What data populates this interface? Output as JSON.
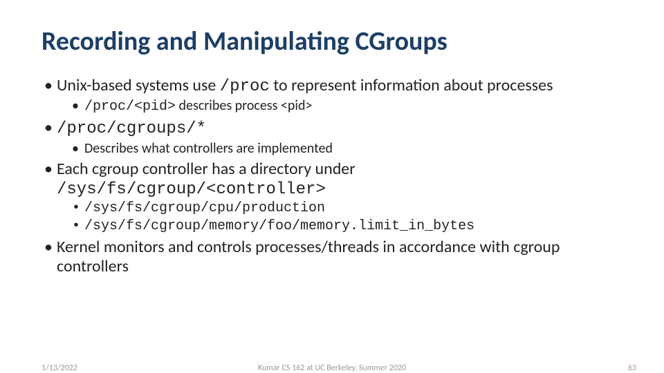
{
  "title": "Recording and Manipulating CGroups",
  "b1": {
    "pre": "Unix-based systems use ",
    "code": "/proc",
    "post": " to represent information about processes",
    "sub": {
      "code": "/proc/<pid>",
      "post": " describes process <pid>"
    }
  },
  "b2": {
    "code": "/proc/cgroups/*",
    "sub": "Describes what controllers are implemented"
  },
  "b3": {
    "text": "Each cgroup controller has a directory under",
    "code": "/sys/fs/cgroup/<controller>",
    "sub1": "/sys/fs/cgroup/cpu/production",
    "sub2": "/sys/fs/cgroup/memory/foo/memory.limit_in_bytes"
  },
  "b4": "Kernel monitors and controls processes/threads in accordance with cgroup controllers",
  "footer": {
    "date": "1/13/2022",
    "center": "Kumar CS 162 at UC Berkeley, Summer 2020",
    "page": "63"
  }
}
